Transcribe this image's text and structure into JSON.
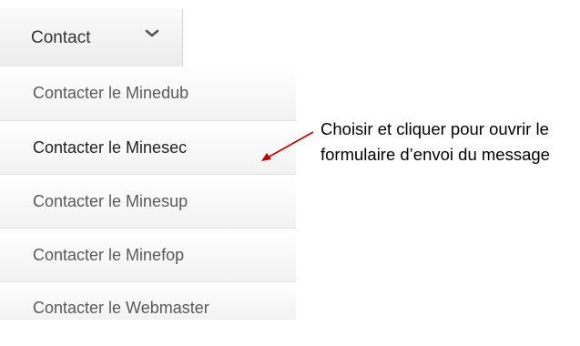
{
  "nav": {
    "contact_label": "Contact",
    "chevron_icon": "chevron-down-icon"
  },
  "menu": {
    "items": [
      {
        "label": "Contacter le Minedub"
      },
      {
        "label": "Contacter le Minesec"
      },
      {
        "label": "Contacter le Minesup"
      },
      {
        "label": "Contacter le Minefop"
      },
      {
        "label": "Contacter le Webmaster"
      }
    ]
  },
  "annotation": {
    "line1": "Choisir et cliquer pour ouvrir le",
    "line2": "formulaire d’envoi du message",
    "arrow_color": "#c00000"
  }
}
